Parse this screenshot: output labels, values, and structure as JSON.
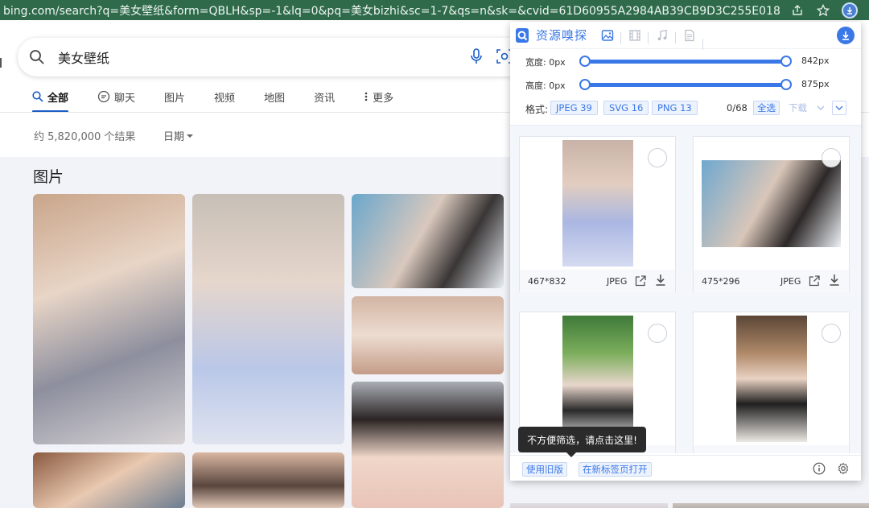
{
  "browser": {
    "url": "bing.com/search?q=美女壁纸&form=QBLH&sp=-1&lq=0&pq=美女bizhi&sc=1-7&qs=n&sk=&cvid=61D60955A2984AB39CB9D3C255E018BE&gh..."
  },
  "search": {
    "query": "美女壁纸"
  },
  "tabs": [
    {
      "label": "全部",
      "icon": "search-icon",
      "active": true
    },
    {
      "label": "聊天",
      "icon": "chat-icon",
      "active": false
    },
    {
      "label": "图片",
      "active": false
    },
    {
      "label": "视频",
      "active": false
    },
    {
      "label": "地图",
      "active": false
    },
    {
      "label": "资讯",
      "active": false
    },
    {
      "label": "更多",
      "icon": "more-icon",
      "active": false
    }
  ],
  "results": {
    "count": "约 5,820,000 个结果",
    "date_filter": "日期",
    "section_title": "图片"
  },
  "panel": {
    "title": "资源嗅探",
    "accent": "#3b78e7",
    "width": {
      "label": "宽度: 0px",
      "max": "842px"
    },
    "height": {
      "label": "高度: 0px",
      "max": "875px"
    },
    "format_label": "格式:",
    "formats": [
      {
        "label": "JPEG",
        "count": "39"
      },
      {
        "label": "SVG",
        "count": "16"
      },
      {
        "label": "PNG",
        "count": "13"
      }
    ],
    "selected": "0/68",
    "select_all": "全选",
    "download": "下载",
    "cards": [
      {
        "dims": "467*832",
        "type": "JPEG"
      },
      {
        "dims": "475*296",
        "type": "JPEG"
      },
      {
        "dims": "",
        "type": ""
      },
      {
        "dims": "",
        "type": ""
      }
    ],
    "footer": {
      "old_version": "使用旧版",
      "open_new_tab": "在新标签页打开"
    },
    "tooltip": "不方便筛选，请点击这里!"
  }
}
